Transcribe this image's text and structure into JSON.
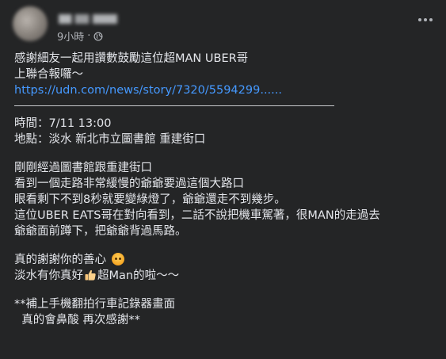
{
  "post": {
    "timestamp": "9小時",
    "privacy_icon": "globe-icon",
    "more_icon": "more-options-icon",
    "lines_intro": [
      "感謝細友一起用讚數鼓勵這位超MAN UBER哥",
      "上聯合報囉～"
    ],
    "link": "https://udn.com/news/story/7320/5594299......",
    "time_line": "時間：7/11   13:00",
    "place_line": "地點：淡水 新北市立圖書館 重建街口",
    "story": [
      "剛剛經過圖書館跟重建街口",
      "看到一個走路非常緩慢的爺爺要過這個大路口",
      "眼看剩下不到8秒就要變綠燈了，爺爺還走不到幾步。",
      "這位UBER EATS哥在對向看到，二話不說把機車駕著，很MAN的走過去",
      "爺爺面前蹲下，把爺爺背過馬路。"
    ],
    "thanks_line": "真的謝謝你的善心",
    "thanks_emoji": "blushing-face-emoji",
    "praise_before": "淡水有你真好",
    "praise_emoji": "thumbs-up-emoji",
    "praise_after": "超Man的啦～～",
    "footer": [
      "**補上手機翻拍行車記錄器畫面",
      "  真的會鼻酸 再次感謝**"
    ]
  },
  "colors": {
    "background": "#242526",
    "text": "#e4e6eb",
    "secondary_text": "#b0b3b8",
    "link": "#4599ff"
  }
}
